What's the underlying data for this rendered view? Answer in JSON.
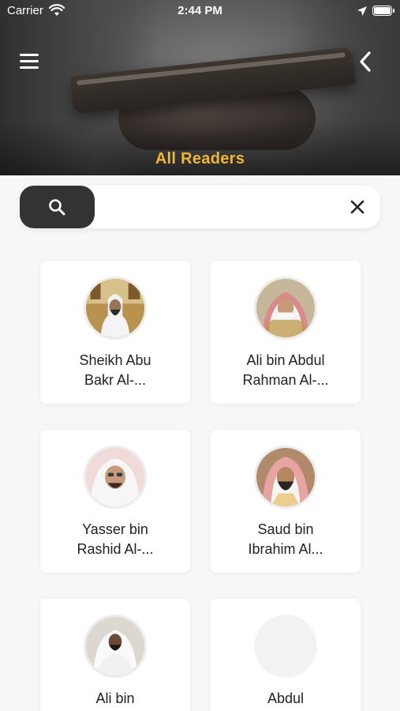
{
  "status_bar": {
    "carrier": "Carrier",
    "time": "2:44 PM"
  },
  "header": {
    "title": "All Readers",
    "menu_icon": "hamburger-menu-icon",
    "back_icon": "chevron-left-icon"
  },
  "search": {
    "placeholder": "",
    "value": "",
    "search_icon": "search-icon",
    "clear_icon": "close-icon"
  },
  "colors": {
    "accent": "#f2b632",
    "search_button": "#333333",
    "background": "#f7f7f7"
  },
  "readers": [
    {
      "name_line1": "Sheikh Abu",
      "name_line2": "Bakr Al-...",
      "has_photo": true
    },
    {
      "name_line1": "Ali bin Abdul",
      "name_line2": "Rahman Al-...",
      "has_photo": true
    },
    {
      "name_line1": "Yasser bin",
      "name_line2": "Rashid Al-...",
      "has_photo": true
    },
    {
      "name_line1": "Saud bin",
      "name_line2": "Ibrahim Al...",
      "has_photo": true
    },
    {
      "name_line1": "Ali bin",
      "name_line2": "",
      "has_photo": true
    },
    {
      "name_line1": "Abdul",
      "name_line2": "",
      "has_photo": false
    }
  ]
}
